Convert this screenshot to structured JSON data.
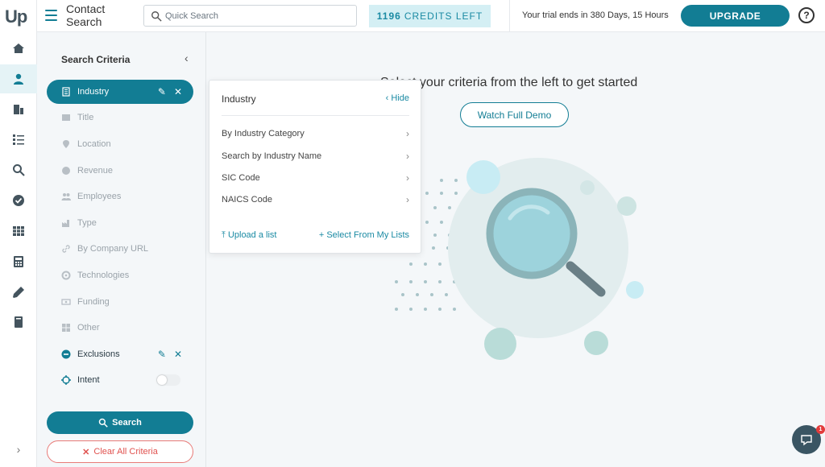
{
  "app": {
    "logo": "Up"
  },
  "topbar": {
    "page_title": "Contact Search",
    "search_placeholder": "Quick Search",
    "credits_count": "1196",
    "credits_label": "CREDITS LEFT",
    "trial_text": "Your trial ends in 380 Days, 15 Hours",
    "upgrade_label": "UPGRADE",
    "help_label": "?"
  },
  "rail": {
    "icons": [
      "home-icon",
      "person-icon",
      "building-icon",
      "list-icon",
      "search-icon",
      "check-circle-icon",
      "table-icon",
      "calculator-icon",
      "pen-icon",
      "book-icon"
    ],
    "active": "person-icon",
    "expand_label": "›"
  },
  "criteria": {
    "heading": "Search Criteria",
    "collapse_label": "‹",
    "items": [
      {
        "label": "Industry",
        "icon": "building-icon",
        "state": "selected"
      },
      {
        "label": "Title",
        "icon": "id-card-icon",
        "state": "muted"
      },
      {
        "label": "Location",
        "icon": "pin-icon",
        "state": "muted"
      },
      {
        "label": "Revenue",
        "icon": "dollar-icon",
        "state": "muted"
      },
      {
        "label": "Employees",
        "icon": "people-icon",
        "state": "muted"
      },
      {
        "label": "Type",
        "icon": "factory-icon",
        "state": "muted"
      },
      {
        "label": "By Company URL",
        "icon": "link-icon",
        "state": "muted"
      },
      {
        "label": "Technologies",
        "icon": "gear-icon",
        "state": "muted"
      },
      {
        "label": "Funding",
        "icon": "money-icon",
        "state": "muted"
      },
      {
        "label": "Other",
        "icon": "grid-icon",
        "state": "muted"
      },
      {
        "label": "Exclusions",
        "icon": "minus-circle-icon",
        "state": "dark"
      },
      {
        "label": "Intent",
        "icon": "crosshair-icon",
        "state": "dark"
      }
    ],
    "search_label": "Search",
    "clear_label": "Clear All Criteria"
  },
  "popover": {
    "title": "Industry",
    "hide_label": "Hide",
    "rows": [
      "By Industry Category",
      "Search by Industry Name",
      "SIC Code",
      "NAICS Code"
    ],
    "upload_label": "Upload a list",
    "lists_label": "Select From My Lists"
  },
  "main": {
    "message": "Select your criteria from the left to get started",
    "demo_label": "Watch Full Demo"
  },
  "chat": {
    "badge": "1"
  },
  "colors": {
    "accent": "#127d94",
    "credits_bg": "#d4eff4",
    "danger": "#e0524f"
  }
}
